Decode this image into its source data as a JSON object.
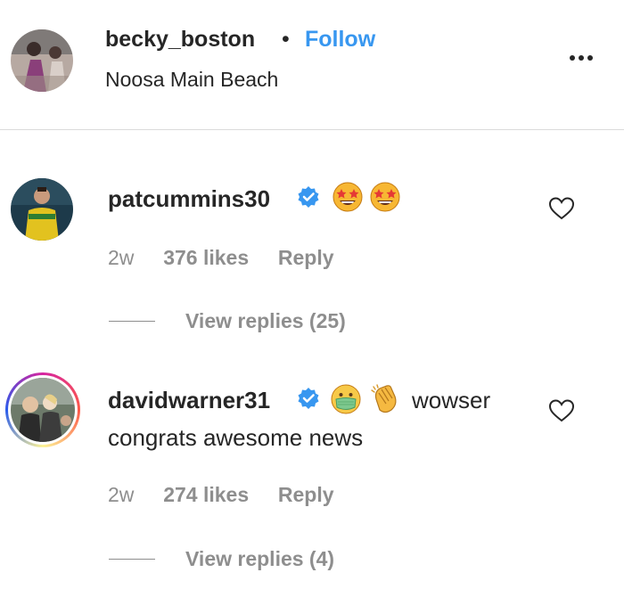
{
  "post_header": {
    "username": "becky_boston",
    "separator": "•",
    "follow_label": "Follow",
    "location": "Noosa Main Beach",
    "more_icon": "more-horizontal-icon"
  },
  "comments": [
    {
      "username": "patcummins30",
      "verified": true,
      "text": "",
      "emojis": [
        "star-struck-face",
        "star-struck-face"
      ],
      "time": "2w",
      "likes": "376 likes",
      "reply_label": "Reply",
      "view_replies": "View replies (25)",
      "avatar_story_ring": false
    },
    {
      "username": "davidwarner31",
      "verified": true,
      "emojis": [
        "face-with-medical-mask",
        "clapping-hands"
      ],
      "text_inline": "wowser",
      "text_line2": "congrats awesome news",
      "time": "2w",
      "likes": "274 likes",
      "reply_label": "Reply",
      "view_replies": "View replies (4)",
      "avatar_story_ring": true
    }
  ],
  "colors": {
    "follow": "#3897f0",
    "verified_badge": "#3897f0",
    "meta_gray": "#8e8e8e",
    "text": "#262626"
  }
}
